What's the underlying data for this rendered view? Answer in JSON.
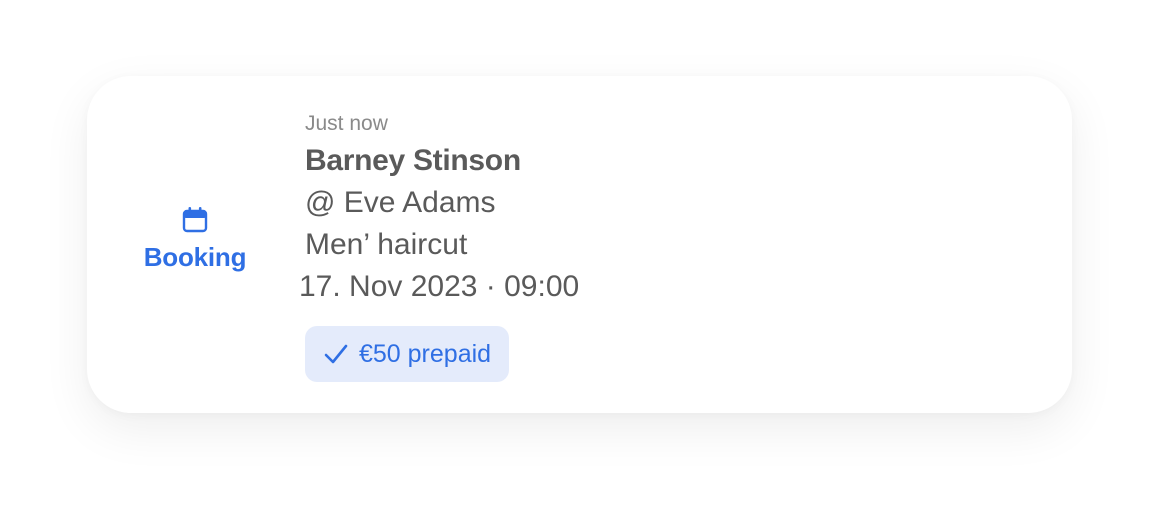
{
  "notification": {
    "type_icon": "calendar-icon",
    "type_label": "Booking",
    "timestamp": "Just now",
    "customer_name": "Barney Stinson",
    "staff": "@ Eve Adams",
    "service": "Men’ haircut",
    "datetime": "17. Nov 2023 · 09:00",
    "payment_badge": {
      "icon": "check-icon",
      "label": "€50 prepaid"
    }
  },
  "colors": {
    "accent": "#2f6fe4",
    "badge_background": "#e4ebfb",
    "text_primary": "#5a5a5a",
    "text_secondary": "#8a8a8a",
    "card_background": "#ffffff"
  }
}
